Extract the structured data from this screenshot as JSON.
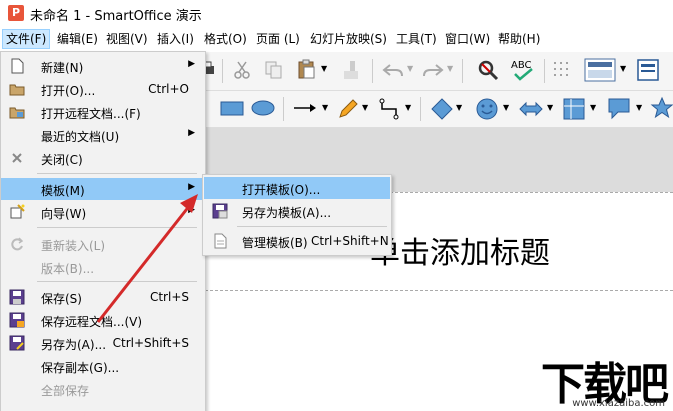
{
  "window": {
    "title": "未命名 1 - SmartOffice 演示",
    "logo_letter": "P"
  },
  "menubar": [
    {
      "label": "文件(F)",
      "name": "menu-file"
    },
    {
      "label": "编辑(E)",
      "name": "menu-edit"
    },
    {
      "label": "视图(V)",
      "name": "menu-view"
    },
    {
      "label": "插入(I)",
      "name": "menu-insert"
    },
    {
      "label": "格式(O)",
      "name": "menu-format"
    },
    {
      "label": "页面 (L)",
      "name": "menu-page"
    },
    {
      "label": "幻灯片放映(S)",
      "name": "menu-slideshow"
    },
    {
      "label": "工具(T)",
      "name": "menu-tools"
    },
    {
      "label": "窗口(W)",
      "name": "menu-window"
    },
    {
      "label": "帮助(H)",
      "name": "menu-help"
    }
  ],
  "file_menu": {
    "items": [
      {
        "label": "新建(N)",
        "shortcut": "",
        "submenu": true,
        "icon": "new-doc-icon"
      },
      {
        "label": "打开(O)...",
        "shortcut": "Ctrl+O",
        "submenu": false,
        "icon": "open-folder-icon"
      },
      {
        "label": "打开远程文档...(F)",
        "shortcut": "",
        "submenu": false,
        "icon": "open-remote-icon"
      },
      {
        "label": "最近的文档(U)",
        "shortcut": "",
        "submenu": true,
        "icon": ""
      },
      {
        "label": "关闭(C)",
        "shortcut": "",
        "submenu": false,
        "icon": "close-icon"
      },
      {
        "label": "模板(M)",
        "shortcut": "",
        "submenu": true,
        "icon": ""
      },
      {
        "label": "向导(W)",
        "shortcut": "",
        "submenu": true,
        "icon": "wizard-icon"
      },
      {
        "label": "重新装入(L)",
        "shortcut": "",
        "submenu": false,
        "icon": "reload-icon"
      },
      {
        "label": "版本(B)...",
        "shortcut": "",
        "submenu": false,
        "icon": ""
      },
      {
        "label": "保存(S)",
        "shortcut": "Ctrl+S",
        "submenu": false,
        "icon": "save-icon"
      },
      {
        "label": "保存远程文档...(V)",
        "shortcut": "",
        "submenu": false,
        "icon": "save-remote-icon"
      },
      {
        "label": "另存为(A)...",
        "shortcut": "Ctrl+Shift+S",
        "submenu": false,
        "icon": "save-as-icon"
      },
      {
        "label": "保存副本(G)...",
        "shortcut": "",
        "submenu": false,
        "icon": ""
      },
      {
        "label": "全部保存",
        "shortcut": "",
        "submenu": false,
        "icon": ""
      }
    ]
  },
  "template_submenu": {
    "items": [
      {
        "label": "打开模板(O)...",
        "shortcut": ""
      },
      {
        "label": "另存为模板(A)...",
        "shortcut": ""
      },
      {
        "label": "管理模板(B)",
        "shortcut": "Ctrl+Shift+N"
      }
    ]
  },
  "slide": {
    "title_placeholder": "单击添加标题"
  },
  "watermark": {
    "big": "下载吧",
    "small": "www.xiazaiba.com"
  },
  "colors": {
    "accent": "#91c9f7",
    "arrow": "#d42a2a",
    "logo": "#e8553a"
  }
}
